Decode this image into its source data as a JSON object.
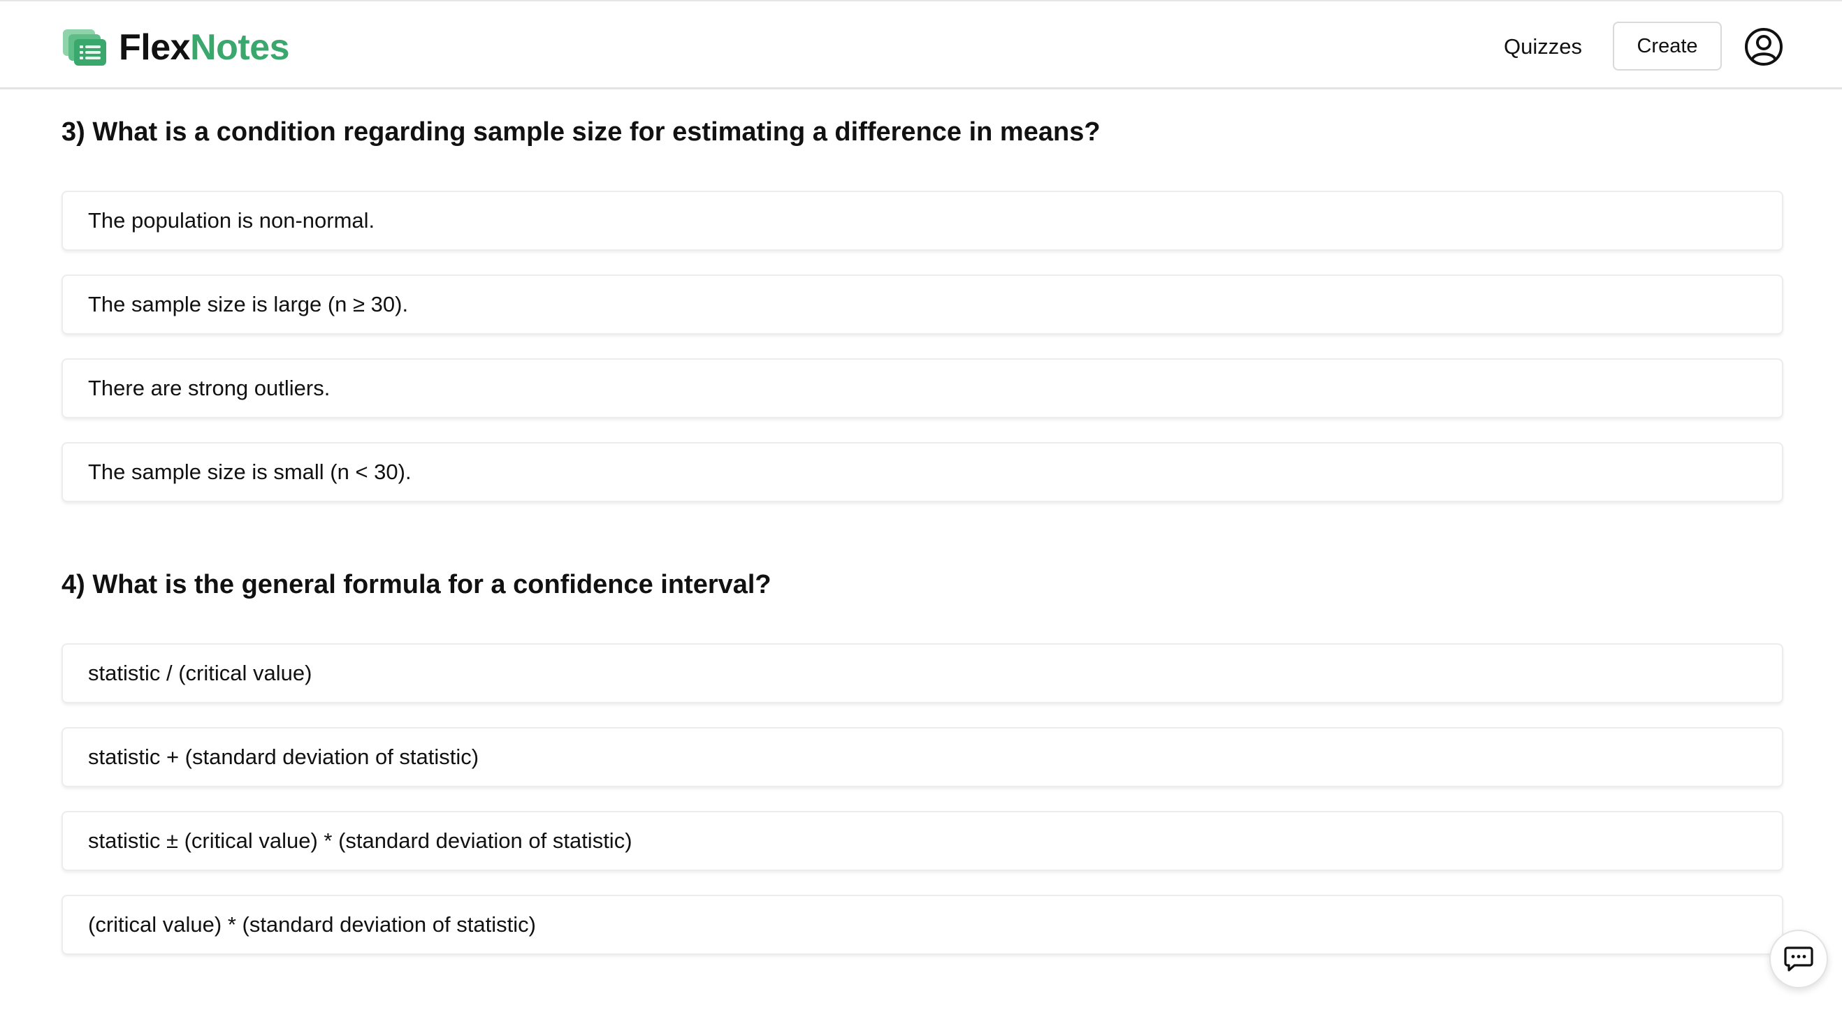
{
  "header": {
    "logo_part1": "Flex",
    "logo_part2": "Notes",
    "nav_quizzes": "Quizzes",
    "create_label": "Create",
    "profile_icon": "user-circle-icon",
    "brand_color": "#3aa76d"
  },
  "questions": [
    {
      "title": "3) What is a condition regarding sample size for estimating a difference in means?",
      "options": [
        "The population is non-normal.",
        "The sample size is large (n ≥ 30).",
        "There are strong outliers.",
        "The sample size is small (n < 30)."
      ]
    },
    {
      "title": "4) What is the general formula for a confidence interval?",
      "options": [
        "statistic / (critical value)",
        "statistic + (standard deviation of statistic)",
        "statistic ± (critical value) * (standard deviation of statistic)",
        "(critical value) * (standard deviation of statistic)"
      ]
    }
  ],
  "chat": {
    "icon": "chat-bubble-icon"
  }
}
